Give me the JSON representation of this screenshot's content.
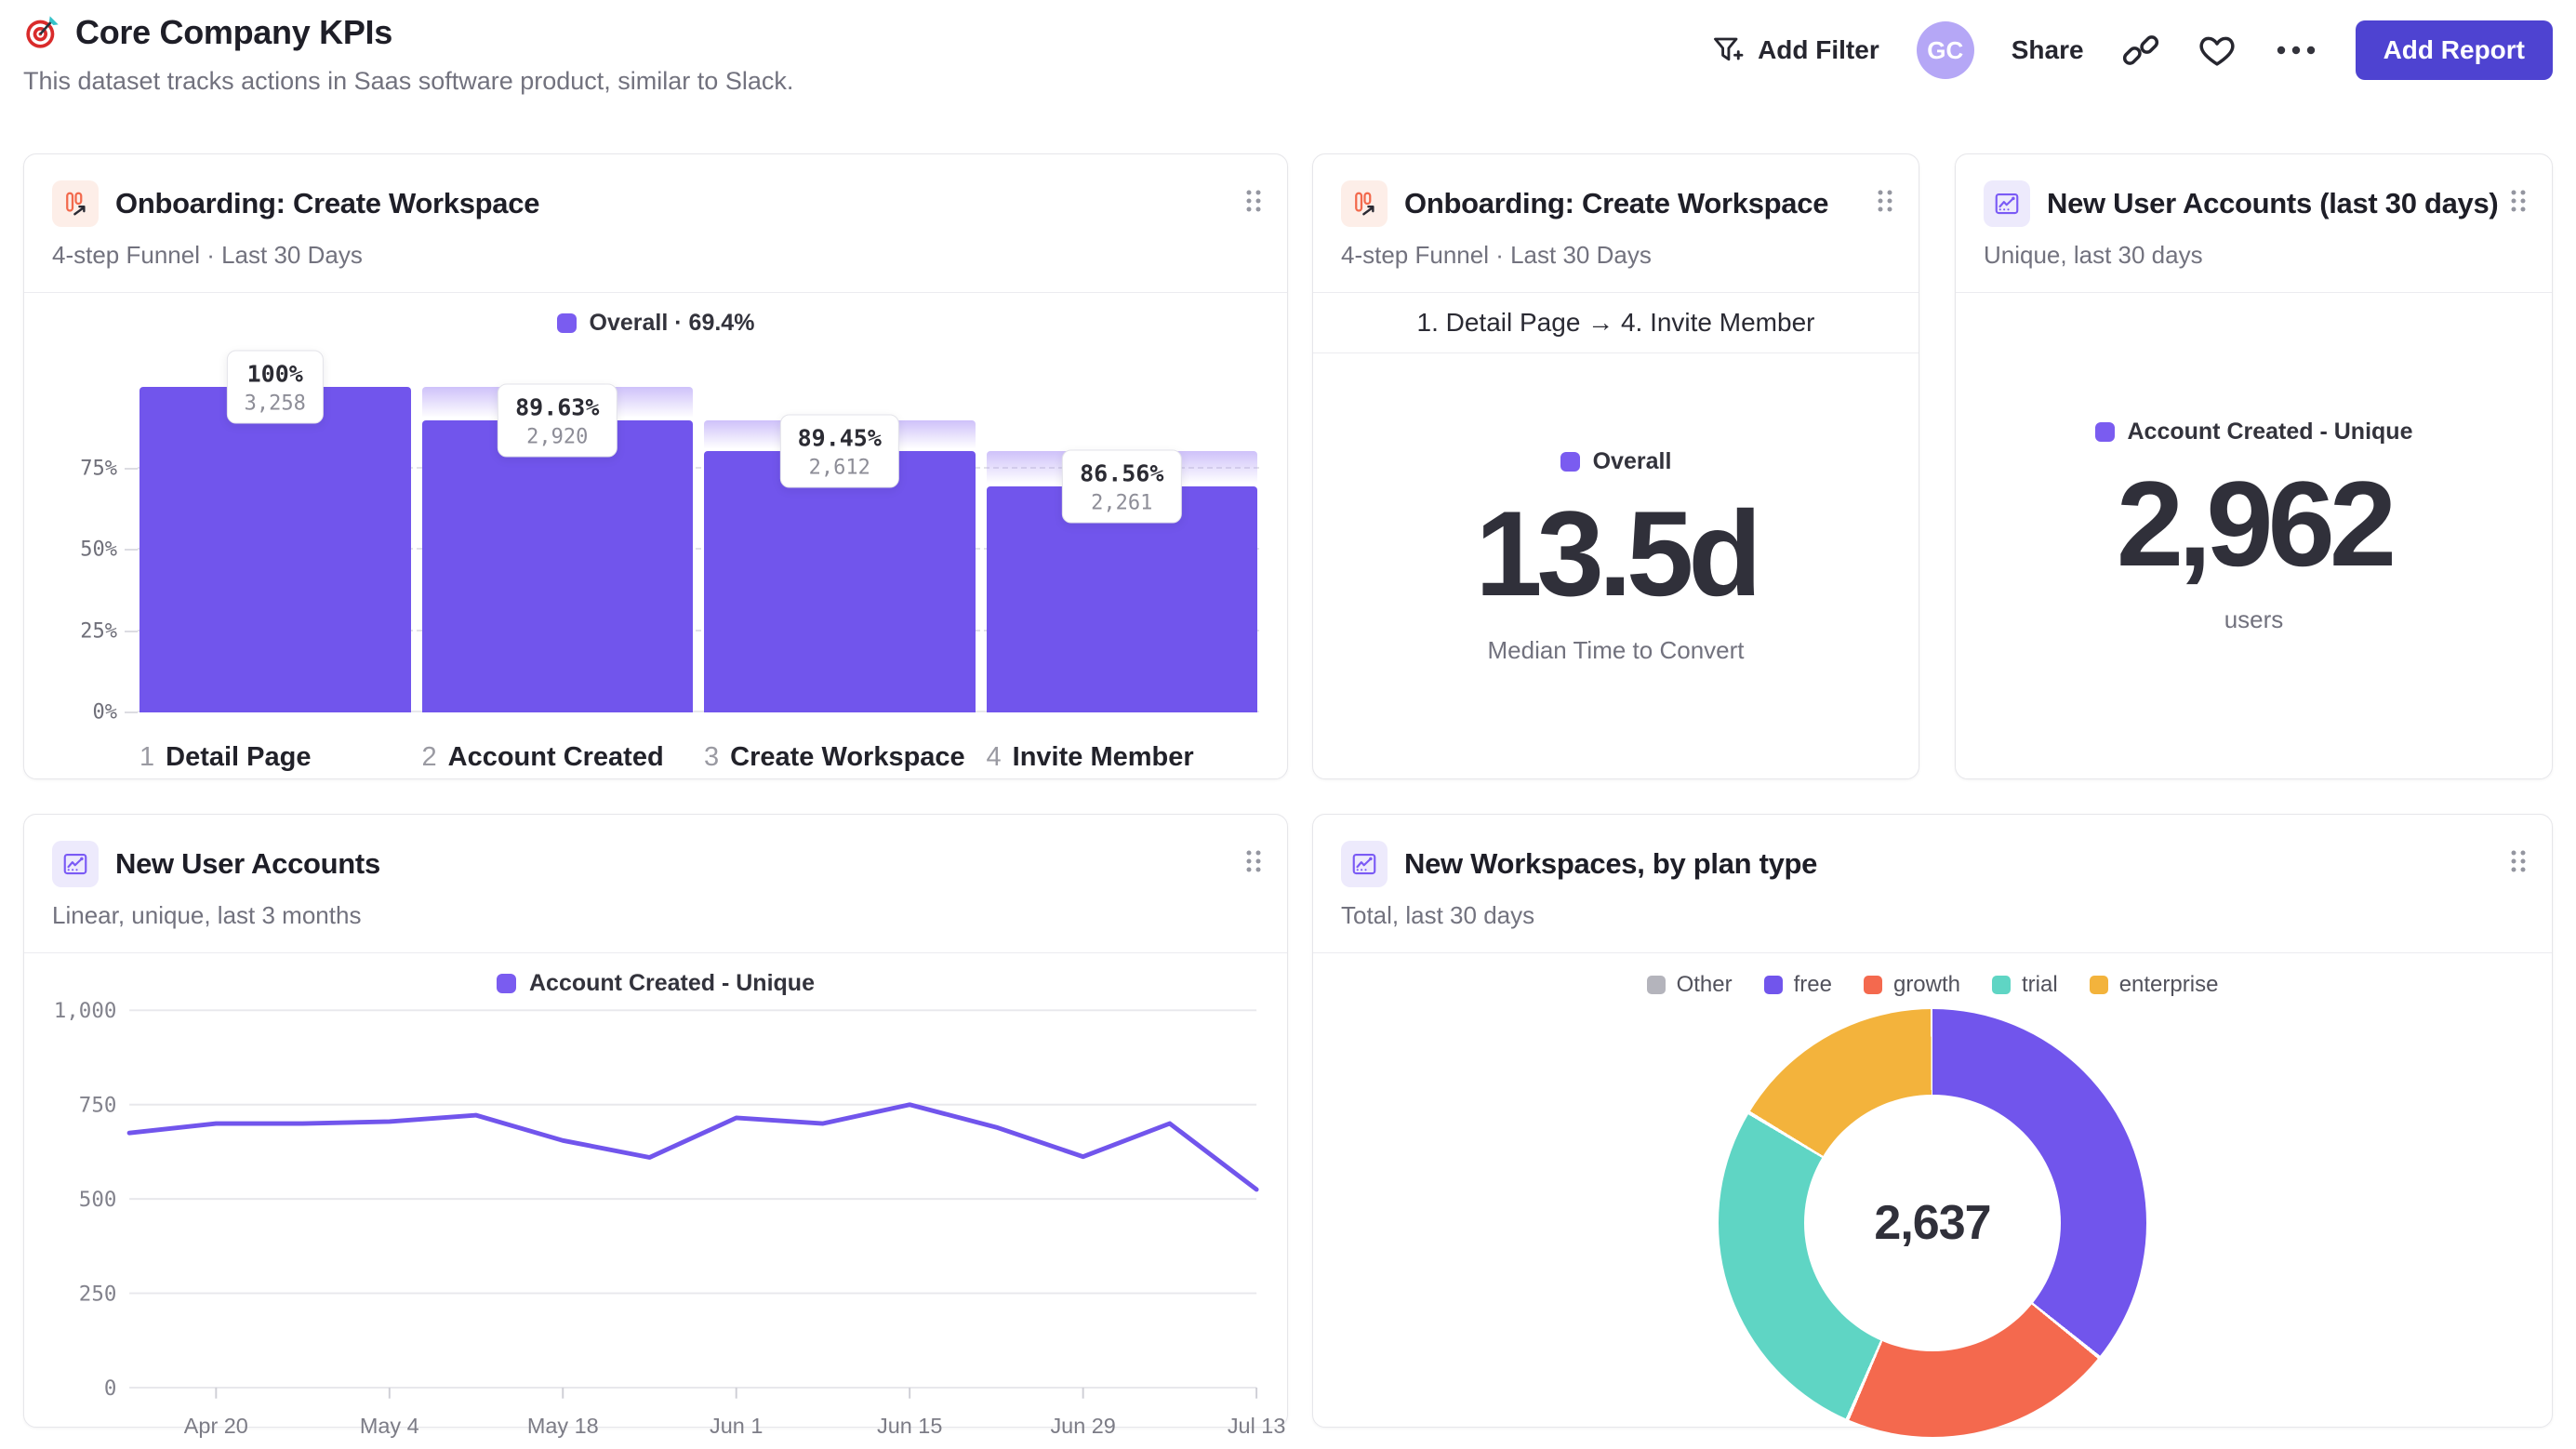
{
  "header": {
    "title": "Core Company KPIs",
    "subtitle": "This dataset tracks actions in Saas software product, similar to Slack.",
    "actions": {
      "add_filter": "Add Filter",
      "avatar_initials": "GC",
      "share": "Share",
      "add_report": "Add Report"
    },
    "icons": [
      "dart-target-icon",
      "filter-plus-icon",
      "link-icon",
      "heart-icon",
      "ellipsis-icon"
    ]
  },
  "cards": {
    "funnel": {
      "icon": "funnel-chart-icon",
      "title": "Onboarding: Create Workspace",
      "subtitle": "4-step Funnel · Last 30 Days",
      "legend": "Overall · 69.4%"
    },
    "time_to_convert": {
      "icon": "funnel-chart-icon",
      "title": "Onboarding: Create Workspace",
      "subtitle": "4-step Funnel · Last 30 Days",
      "range_label": "1. Detail Page → 4. Invite Member",
      "legend": "Overall",
      "metric": "13.5d",
      "caption": "Median Time to Convert"
    },
    "new_accounts_30d": {
      "icon": "line-chart-icon",
      "title": "New User Accounts (last 30 days)",
      "subtitle": "Unique, last 30 days",
      "legend": "Account Created - Unique",
      "metric": "2,962",
      "caption": "users"
    },
    "new_accounts_trend": {
      "icon": "line-chart-icon",
      "title": "New User Accounts",
      "subtitle": "Linear, unique, last 3 months",
      "legend": "Account Created - Unique"
    },
    "workspaces_by_plan": {
      "icon": "line-chart-icon",
      "title": "New Workspaces, by plan type",
      "subtitle": "Total, last 30 days",
      "center_value": "2,637"
    }
  },
  "colors": {
    "purple": "#7155ec",
    "coral": "#f4694e",
    "teal": "#5fd5c4",
    "amber": "#f3b33c",
    "gray": "#b4b4bc",
    "button": "#4e43d1"
  },
  "chart_data": [
    {
      "id": "onboarding_funnel",
      "type": "bar",
      "subtype": "funnel",
      "title": "Onboarding: Create Workspace",
      "legend": "Overall · 69.4%",
      "overall_conversion_pct": 69.4,
      "color": "#7155ec",
      "yticks": [
        "0%",
        "25%",
        "50%",
        "75%"
      ],
      "steps": [
        {
          "index": 1,
          "label": "Detail Page",
          "count": 3258,
          "count_display": "3,258",
          "step_pct_display": "100%",
          "overall_pct": 100
        },
        {
          "index": 2,
          "label": "Account Created",
          "count": 2920,
          "count_display": "2,920",
          "step_pct_display": "89.63%",
          "overall_pct": 89.63
        },
        {
          "index": 3,
          "label": "Create Workspace",
          "count": 2612,
          "count_display": "2,612",
          "step_pct_display": "89.45%",
          "overall_pct": 80.17
        },
        {
          "index": 4,
          "label": "Invite Member",
          "count": 2261,
          "count_display": "2,261",
          "step_pct_display": "86.56%",
          "overall_pct": 69.4
        }
      ]
    },
    {
      "id": "median_time_to_convert",
      "type": "metric",
      "title": "Onboarding: Create Workspace",
      "series": "Overall",
      "value": "13.5d",
      "label": "Median Time to Convert"
    },
    {
      "id": "new_user_accounts_total",
      "type": "metric",
      "title": "New User Accounts (last 30 days)",
      "series": "Account Created - Unique",
      "value": "2,962",
      "label": "users"
    },
    {
      "id": "new_user_accounts_trend",
      "type": "line",
      "title": "New User Accounts",
      "ylim": [
        0,
        1000
      ],
      "yticks": [
        0,
        250,
        500,
        750,
        1000
      ],
      "x_tick_labels": [
        "Apr 20",
        "May 4",
        "May 18",
        "Jun 1",
        "Jun 15",
        "Jun 29",
        "Jul 13"
      ],
      "label_indices": [
        1,
        3,
        5,
        7,
        9,
        11,
        13
      ],
      "grid": true,
      "legend_position": "top",
      "series": [
        {
          "name": "Account Created - Unique",
          "color": "#7155ec",
          "values": [
            675,
            700,
            700,
            705,
            722,
            655,
            610,
            715,
            700,
            750,
            690,
            612,
            700,
            525
          ]
        }
      ]
    },
    {
      "id": "new_workspaces_by_plan",
      "type": "pie",
      "subtype": "donut",
      "title": "New Workspaces, by plan type",
      "total": 2637,
      "total_display": "2,637",
      "legend_order": [
        "Other",
        "free",
        "growth",
        "trial",
        "enterprise"
      ],
      "slices": [
        {
          "label": "free",
          "value": 944,
          "color": "#7155ec"
        },
        {
          "label": "growth",
          "value": 546,
          "color": "#f4694e"
        },
        {
          "label": "trial",
          "value": 715,
          "color": "#5fd5c4"
        },
        {
          "label": "enterprise",
          "value": 432,
          "color": "#f3b33c"
        },
        {
          "label": "Other",
          "value": 0,
          "color": "#b4b4bc"
        }
      ]
    }
  ]
}
